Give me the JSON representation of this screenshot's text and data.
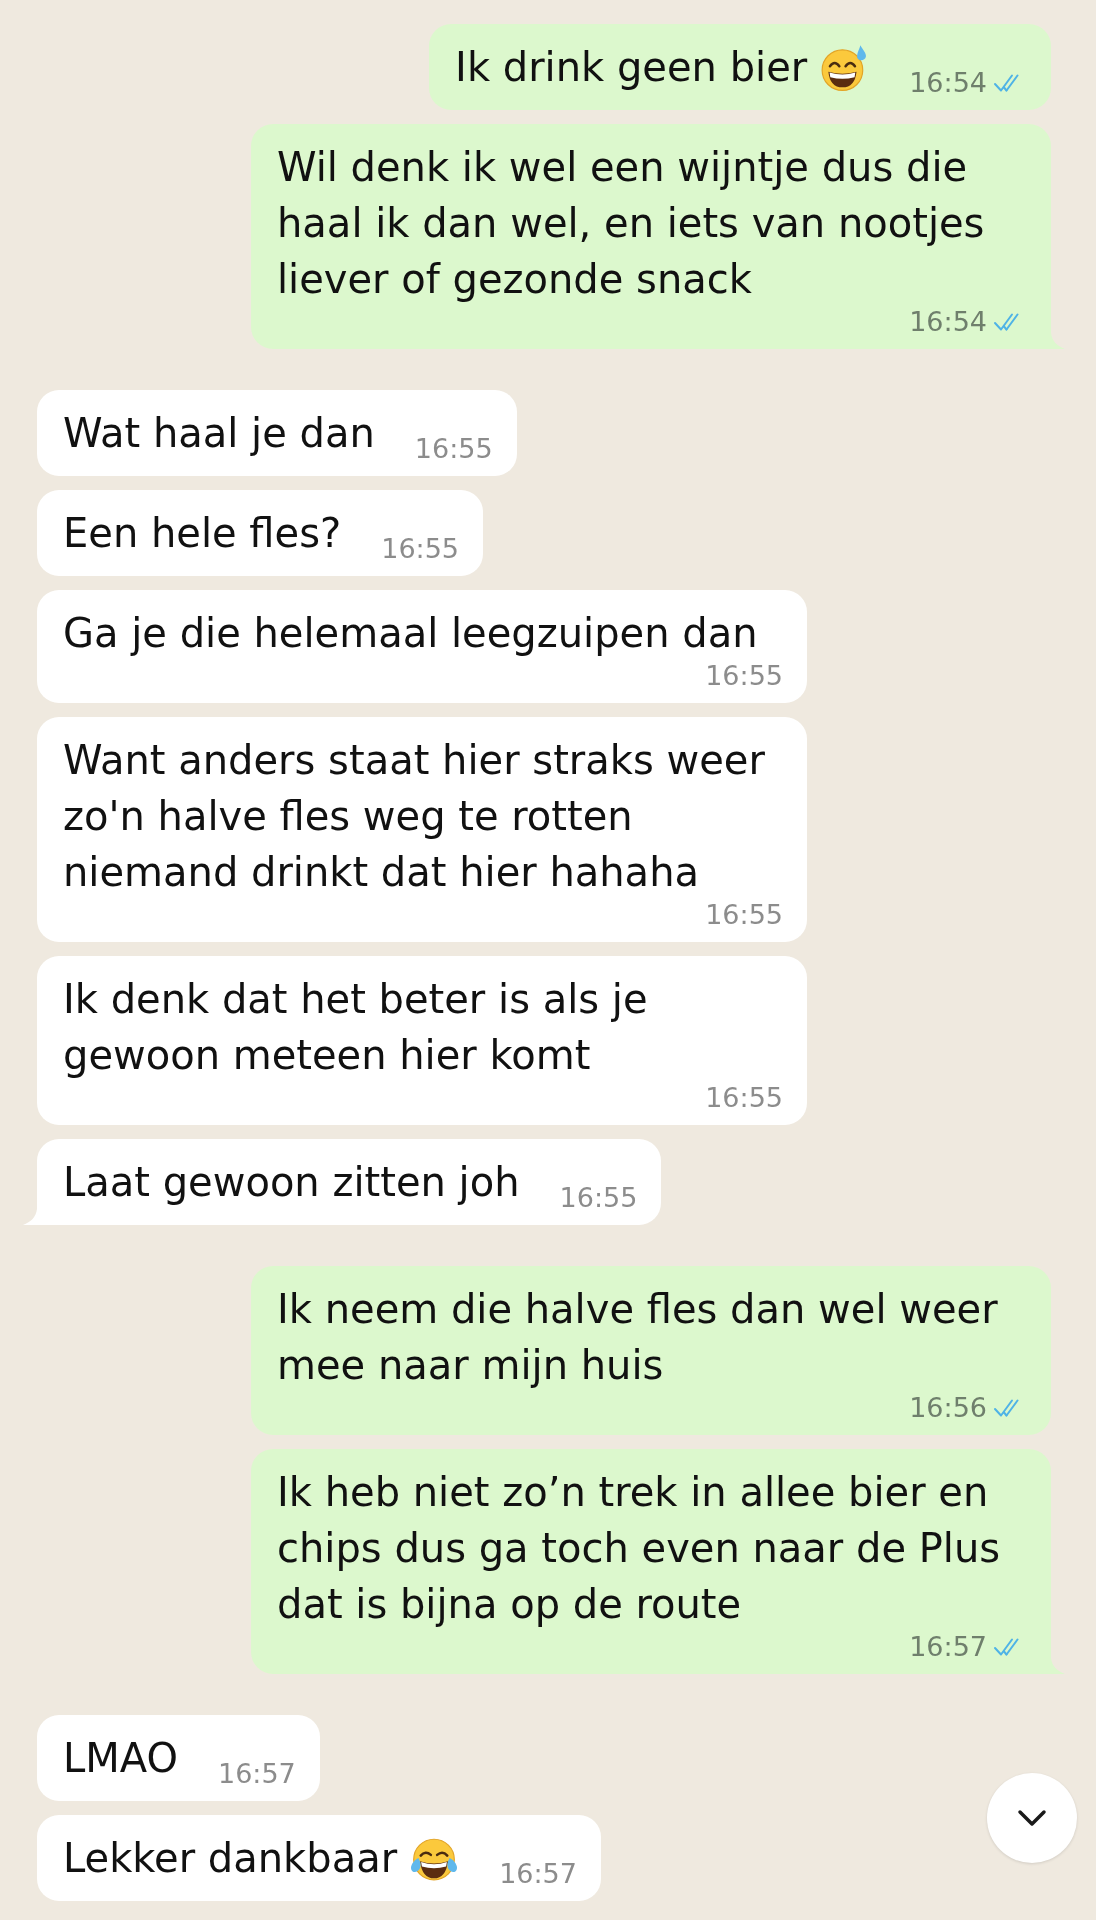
{
  "messages": [
    {
      "kind": "outgoing",
      "text": "Ik drink geen bier",
      "emoji": {
        "kind": "sweat"
      },
      "time": "16:54",
      "read": true,
      "tail": false
    },
    {
      "kind": "outgoing",
      "text": "Wil denk ik wel een wijntje dus die haal ik dan wel, en iets van nootjes liever of gezonde snack",
      "time": "16:54",
      "read": true,
      "tail": true
    },
    {
      "kind": "incoming",
      "text": "Wat haal je dan",
      "time": "16:55",
      "tail": false
    },
    {
      "kind": "incoming",
      "text": "Een hele fles?",
      "time": "16:55",
      "tail": false
    },
    {
      "kind": "incoming",
      "text": "Ga je die helemaal leegzuipen dan",
      "time": "16:55",
      "tail": false
    },
    {
      "kind": "incoming",
      "text": "Want anders staat hier straks weer zo'n halve fles weg te rotten niemand drinkt dat hier hahaha",
      "time": "16:55",
      "tail": false
    },
    {
      "kind": "incoming",
      "text": "Ik denk dat het beter is als je gewoon meteen hier komt",
      "time": "16:55",
      "tail": false
    },
    {
      "kind": "incoming",
      "text": "Laat gewoon zitten joh",
      "time": "16:55",
      "tail": true
    },
    {
      "kind": "outgoing",
      "text": "Ik neem die halve fles dan wel weer mee naar mijn huis",
      "time": "16:56",
      "read": true,
      "tail": false
    },
    {
      "kind": "outgoing",
      "text": "Ik heb niet zo’n trek in allee bier en chips dus ga toch even naar de Plus dat is bijna op de route",
      "time": "16:57",
      "read": true,
      "tail": true
    },
    {
      "kind": "incoming",
      "text": "LMAO",
      "time": "16:57",
      "tail": false
    },
    {
      "kind": "incoming",
      "text": "Lekker dankbaar",
      "emoji": {
        "kind": "joy"
      },
      "time": "16:57",
      "tail": false
    }
  ],
  "scroll_down_button": true
}
